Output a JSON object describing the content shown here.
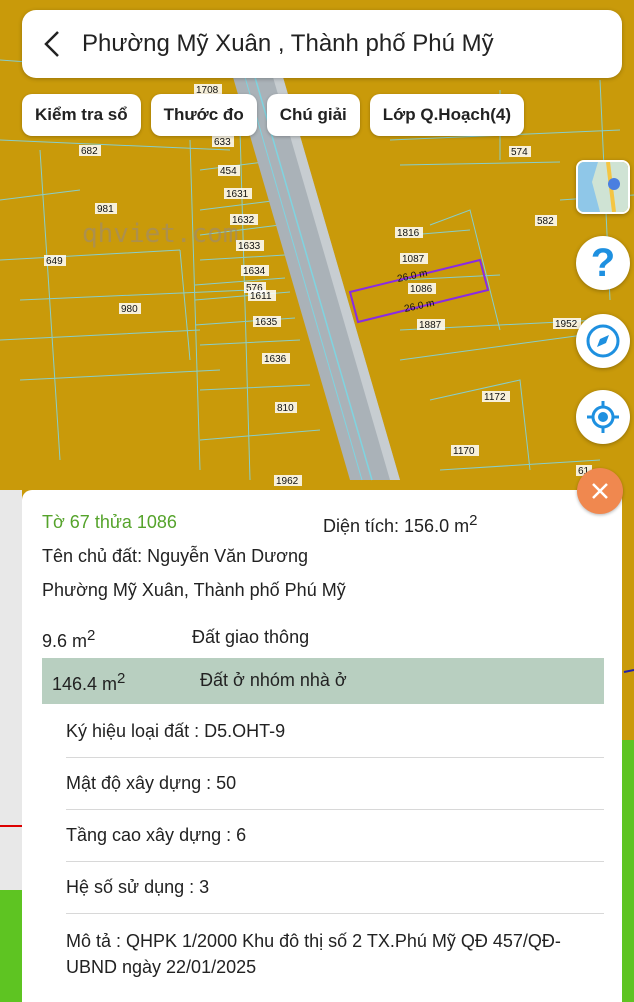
{
  "header": {
    "title": "Phường Mỹ Xuân , Thành phố Phú Mỹ"
  },
  "toolbar": {
    "chips": [
      "Kiểm tra sổ",
      "Thước đo",
      "Chú giải",
      "Lớp Q.Hoạch(4)"
    ]
  },
  "map": {
    "watermark": "qhviet.com",
    "parcel_labels": [
      "1708",
      "682",
      "633",
      "454",
      "1631",
      "981",
      "1632",
      "1633",
      "649",
      "1634",
      "576",
      "1611",
      "980",
      "1635",
      "1636",
      "810",
      "1962",
      "574",
      "582",
      "1816",
      "1087",
      "1086",
      "1887",
      "1952",
      "1172",
      "1170",
      "61"
    ],
    "dimension_labels": [
      "26.0 m",
      "26.0 m"
    ],
    "colors": {
      "land": "#c99a0a",
      "road": "#aab2b8",
      "lines": "#7fd4e0",
      "highlight": "#8a2be2",
      "green": "#5ec422"
    }
  },
  "controls": {
    "help_glyph": "?",
    "icons": [
      "layers-icon",
      "help-icon",
      "compass-icon",
      "locate-icon",
      "close-icon"
    ]
  },
  "info": {
    "sheet_parcel": "Tờ 67 thửa 1086",
    "area_label": "Diện tích: 156.0 m",
    "area_sup": "2",
    "owner": "Tên chủ đất: Nguyễn Văn Dương",
    "address": "Phường Mỹ Xuân, Thành phố Phú Mỹ",
    "uses": [
      {
        "area": "9.6 m",
        "sup": "2",
        "type": "Đất giao thông"
      },
      {
        "area": "146.4 m",
        "sup": "2",
        "type": "Đất ở nhóm nhà ở"
      }
    ],
    "attributes": [
      "Ký hiệu loại đất : D5.OHT-9",
      "Mật độ xây dựng : 50",
      "Tầng cao xây dựng : 6",
      "Hệ số sử dụng : 3"
    ],
    "description": "Mô tả : QHPK 1/2000 Khu đô thị số 2 TX.Phú Mỹ QĐ 457/QĐ-UBND ngày 22/01/2025"
  }
}
